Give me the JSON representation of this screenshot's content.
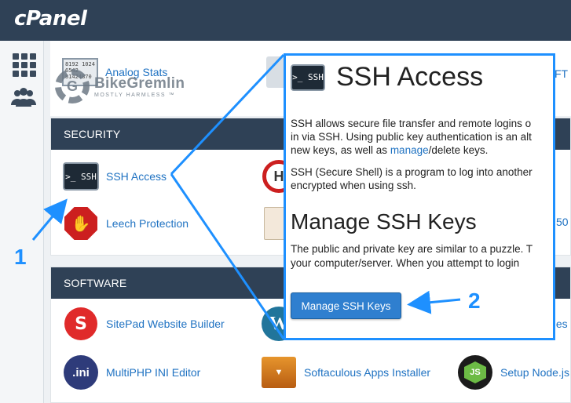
{
  "app": {
    "logo_text": "cPanel"
  },
  "rail": {
    "icons": [
      "grid-icon",
      "users-icon"
    ]
  },
  "watermark": {
    "title": "BikeGremlin",
    "subtitle": "MOSTLY HARMLESS ™"
  },
  "top_partial": {
    "analog_stats": "Analog Stats",
    "right_edge": "FT"
  },
  "security": {
    "header": "SECURITY",
    "items": [
      {
        "label": "SSH Access",
        "icon": "ssh-terminal-icon",
        "tile_text": ">_ SSH"
      },
      {
        "label": "Leech Protection",
        "icon": "stop-hand-icon"
      }
    ],
    "right_edge": "50"
  },
  "software": {
    "header": "SOFTWARE",
    "items": [
      {
        "label": "SitePad Website Builder",
        "icon": "sitepad-icon"
      },
      {
        "label": "MultiPHP INI Editor",
        "icon": "ini-file-icon",
        "icon_text": ".ini"
      },
      {
        "label": "Softaculous Apps Installer",
        "icon": "softaculous-icon"
      },
      {
        "label": "Setup Node.js",
        "icon": "nodejs-icon",
        "icon_text": "JS"
      }
    ],
    "right_edge": "ules"
  },
  "callout": {
    "icon_text": ">_ SSH",
    "title": "SSH Access",
    "para1_line1": "SSH allows secure file transfer and remote logins o",
    "para1_line2": "in via SSH. Using public key authentication is an alt",
    "para1_line3_pre": "new keys, as well as ",
    "para1_link": "manage",
    "para1_line3_post": "/delete keys.",
    "para2_line1": "SSH (Secure Shell) is a program to log into another",
    "para2_line2": "encrypted when using ssh.",
    "subtitle": "Manage SSH Keys",
    "para3_line1": "The public and private key are similar to a puzzle. T",
    "para3_line2": "your computer/server. When you attempt to login",
    "button_label": "Manage SSH Keys"
  },
  "annotations": {
    "step1": "1",
    "step2": "2",
    "color": "#1e90ff"
  }
}
